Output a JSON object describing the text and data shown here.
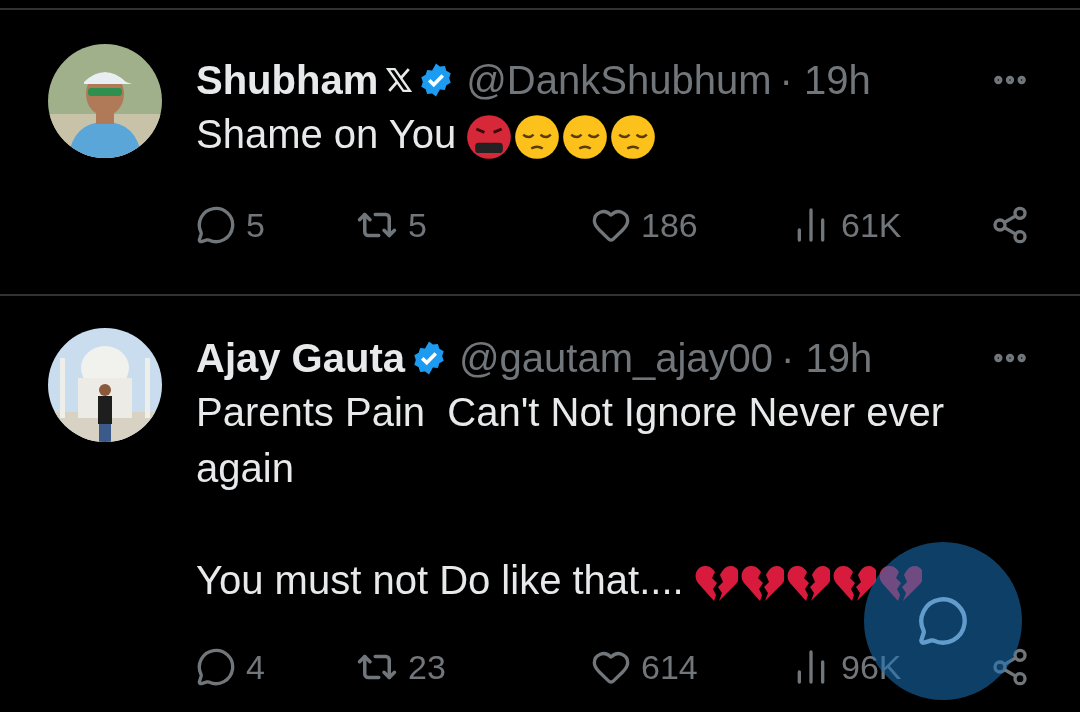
{
  "tweets": [
    {
      "name": "Shubham",
      "name_badge": {
        "kind": "x-logo"
      },
      "verified": true,
      "handle": "@DankShubhum",
      "time": "· 19h",
      "paragraphs": [
        {
          "text": "Shame on You",
          "emojis": [
            {
              "kind": "angry"
            },
            {
              "kind": "pensive"
            },
            {
              "kind": "pensive"
            },
            {
              "kind": "pensive"
            }
          ]
        }
      ],
      "replies": "5",
      "reposts": "5",
      "likes": "186",
      "views": "61K"
    },
    {
      "name": "Ajay Gauta",
      "verified": true,
      "handle": "@gautam_ajay00",
      "time": "· 19h",
      "paragraphs": [
        {
          "text": "Parents Pain  Can't Not Ignore Never ever again"
        },
        {
          "text": "You must not Do like that....",
          "emojis": [
            {
              "kind": "broken-heart"
            },
            {
              "kind": "broken-heart"
            },
            {
              "kind": "broken-heart"
            },
            {
              "kind": "broken-heart"
            },
            {
              "kind": "broken-heart"
            }
          ]
        }
      ],
      "replies": "4",
      "reposts": "23",
      "likes": "614",
      "views": "96K"
    }
  ]
}
